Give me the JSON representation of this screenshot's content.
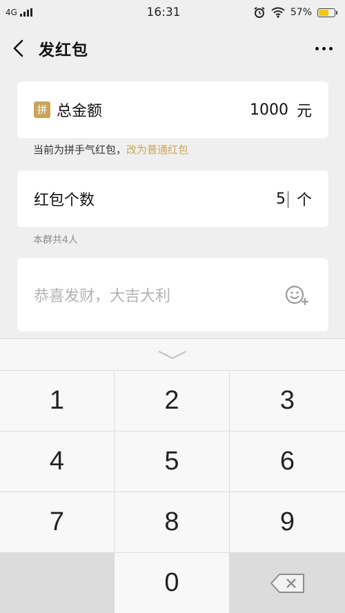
{
  "status_bar": {
    "network": "4G",
    "time": "16:31",
    "battery_percent": "57%",
    "battery_level": 0.57
  },
  "nav": {
    "title": "发红包",
    "back_icon": "chevron-left-icon",
    "more_icon": "more-dots-icon"
  },
  "amount_card": {
    "badge": "拼",
    "label": "总金额",
    "value": "1000",
    "unit": "元"
  },
  "amount_hint": {
    "text": "当前为拼手气红包，",
    "link": "改为普通红包"
  },
  "count_card": {
    "label": "红包个数",
    "value": "5",
    "unit": "个"
  },
  "count_hint": "本群共4人",
  "message_card": {
    "placeholder": "恭喜发财，大吉大利",
    "emoji_icon": "emoji-add-icon"
  },
  "keypad": {
    "collapse_icon": "chevron-down-icon",
    "keys": [
      "1",
      "2",
      "3",
      "4",
      "5",
      "6",
      "7",
      "8",
      "9",
      "",
      "0",
      ""
    ],
    "delete_icon": "backspace-icon"
  },
  "colors": {
    "accent": "#c9a55c",
    "background": "#efefef"
  }
}
